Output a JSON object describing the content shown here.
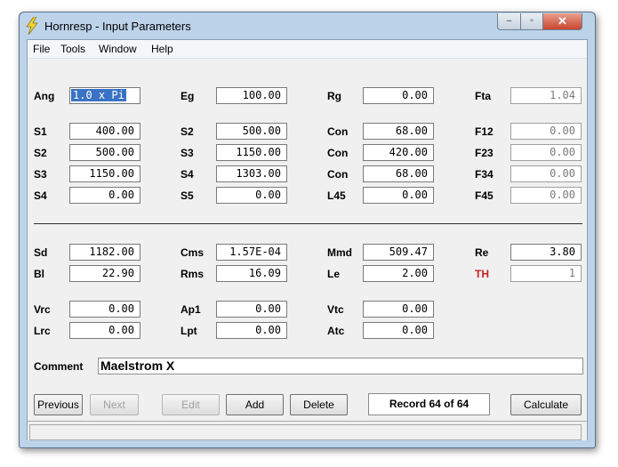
{
  "window": {
    "title": "Hornresp - Input Parameters",
    "minimize": "–",
    "maximize": "▫",
    "close": "✕"
  },
  "menu": [
    "File",
    "Tools",
    "Window",
    "Help"
  ],
  "row1": [
    {
      "label": "Ang",
      "value": "1.0 x Pi"
    },
    {
      "label": "Eg",
      "value": "100.00"
    },
    {
      "label": "Rg",
      "value": "0.00"
    },
    {
      "label": "Fta",
      "value": "1.04"
    }
  ],
  "horn": [
    [
      {
        "label": "S1",
        "value": "400.00"
      },
      {
        "label": "S2",
        "value": "500.00"
      },
      {
        "label": "Con",
        "value": "68.00"
      },
      {
        "label": "F12",
        "value": "0.00"
      }
    ],
    [
      {
        "label": "S2",
        "value": "500.00"
      },
      {
        "label": "S3",
        "value": "1150.00"
      },
      {
        "label": "Con",
        "value": "420.00"
      },
      {
        "label": "F23",
        "value": "0.00"
      }
    ],
    [
      {
        "label": "S3",
        "value": "1150.00"
      },
      {
        "label": "S4",
        "value": "1303.00"
      },
      {
        "label": "Con",
        "value": "68.00"
      },
      {
        "label": "F34",
        "value": "0.00"
      }
    ],
    [
      {
        "label": "S4",
        "value": "0.00"
      },
      {
        "label": "S5",
        "value": "0.00"
      },
      {
        "label": "L45",
        "value": "0.00"
      },
      {
        "label": "F45",
        "value": "0.00"
      }
    ]
  ],
  "driver": [
    [
      {
        "label": "Sd",
        "value": "1182.00"
      },
      {
        "label": "Cms",
        "value": "1.57E-04"
      },
      {
        "label": "Mmd",
        "value": "509.47"
      },
      {
        "label": "Re",
        "value": "3.80"
      }
    ],
    [
      {
        "label": "Bl",
        "value": "22.90"
      },
      {
        "label": "Rms",
        "value": "16.09"
      },
      {
        "label": "Le",
        "value": "2.00"
      },
      {
        "label": "TH",
        "value": "1"
      }
    ]
  ],
  "chamber": [
    [
      {
        "label": "Vrc",
        "value": "0.00"
      },
      {
        "label": "Ap1",
        "value": "0.00"
      },
      {
        "label": "Vtc",
        "value": "0.00"
      }
    ],
    [
      {
        "label": "Lrc",
        "value": "0.00"
      },
      {
        "label": "Lpt",
        "value": "0.00"
      },
      {
        "label": "Atc",
        "value": "0.00"
      }
    ]
  ],
  "comment": {
    "label": "Comment",
    "value": "Maelstrom X"
  },
  "buttons": {
    "previous": "Previous",
    "next": "Next",
    "edit": "Edit",
    "add": "Add",
    "delete": "Delete",
    "calculate": "Calculate"
  },
  "record": "Record 64 of 64",
  "colors": {
    "selection": "#3a72c4",
    "th_label": "#c62020",
    "frame": "#bcd3ea"
  }
}
